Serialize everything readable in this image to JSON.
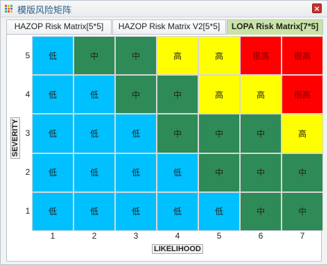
{
  "window": {
    "title": "模版风险矩阵",
    "close_glyph": "×"
  },
  "tabs": [
    {
      "label": "HAZOP Risk Matrix[5*5]",
      "active": false
    },
    {
      "label": "HAZOP Risk Matrix V2[5*5]",
      "active": false
    },
    {
      "label": "LOPA Risk Matrix[7*5]",
      "active": true
    }
  ],
  "matrix": {
    "y_axis_label": "SEVERITY",
    "x_axis_label": "LIKELIHOOD",
    "rows": [
      {
        "severity": "5",
        "cells": [
          "低",
          "中",
          "中",
          "高",
          "高",
          "很高",
          "很高"
        ]
      },
      {
        "severity": "4",
        "cells": [
          "低",
          "低",
          "中",
          "中",
          "高",
          "高",
          "很高"
        ]
      },
      {
        "severity": "3",
        "cells": [
          "低",
          "低",
          "低",
          "中",
          "中",
          "中",
          "高"
        ]
      },
      {
        "severity": "2",
        "cells": [
          "低",
          "低",
          "低",
          "低",
          "中",
          "中",
          "中"
        ]
      },
      {
        "severity": "1",
        "cells": [
          "低",
          "低",
          "低",
          "低",
          "低",
          "中",
          "中"
        ]
      }
    ],
    "likelihood": [
      "1",
      "2",
      "3",
      "4",
      "5",
      "6",
      "7"
    ],
    "level_colors": {
      "低": "#00c0ff",
      "中": "#2e8b57",
      "高": "#ffff00",
      "很高": "#ff0000"
    }
  }
}
